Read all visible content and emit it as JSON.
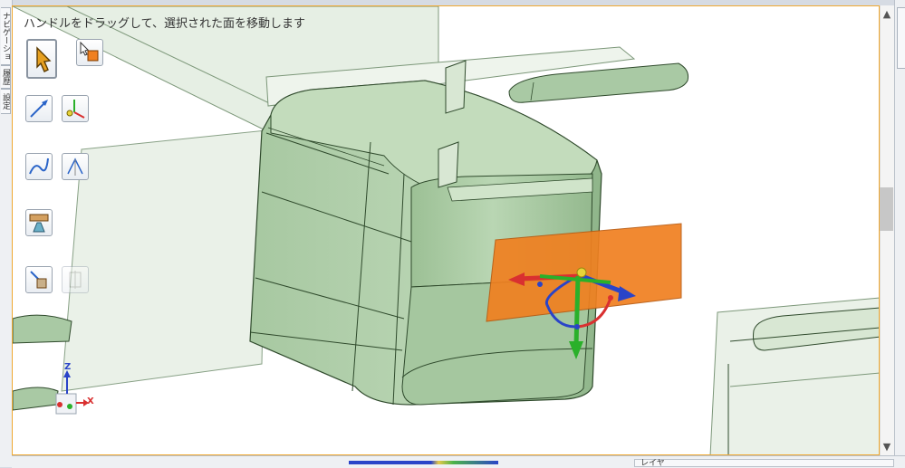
{
  "hint": "ハンドルをドラッグして、選択された面を移動します",
  "side_tabs": [
    "ナビゲーション",
    "履歴",
    "設定"
  ],
  "lower_panel": {
    "label": "レイヤ"
  },
  "axes": {
    "z": "Z",
    "x": "X"
  },
  "toolbar": {
    "tools": [
      {
        "name": "select-tool",
        "icon": "cursor-arrow-icon"
      },
      {
        "name": "select-face-tool",
        "icon": "select-face-icon"
      },
      {
        "name": "line-tool",
        "icon": "line-icon"
      },
      {
        "name": "point-tool",
        "icon": "point-icon"
      },
      {
        "name": "curve-tool",
        "icon": "curve-icon"
      },
      {
        "name": "snap-tool",
        "icon": "snap-icon"
      },
      {
        "name": "part-tool",
        "icon": "part-icon"
      },
      {
        "name": "measure-tool",
        "icon": "measure-icon"
      },
      {
        "name": "disabled-tool",
        "icon": "disabled-icon"
      }
    ]
  },
  "colors": {
    "viewport_border": "#f0a830",
    "model_fill": "#a9c9a4",
    "plane_fill": "#e8f0e6",
    "handle_plane": "#f08020",
    "axis_x": "#d93030",
    "axis_y": "#2a44c8",
    "axis_z": "#2ab02a"
  }
}
